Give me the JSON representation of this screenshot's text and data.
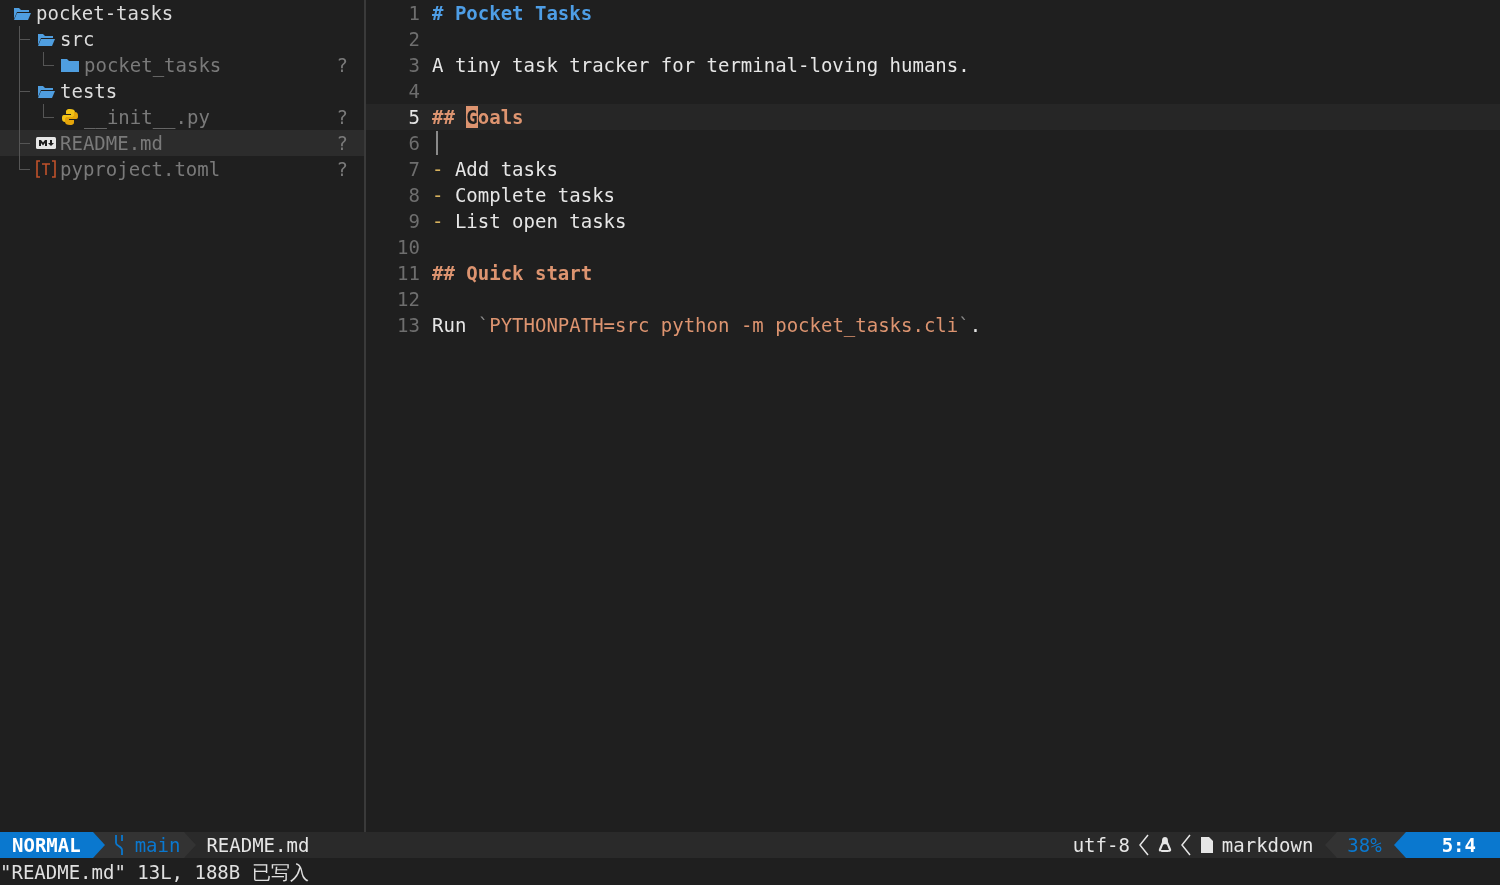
{
  "tree": {
    "root": {
      "name": "pocket-tasks",
      "kind": "open_folder",
      "selected": false,
      "children": [
        {
          "name": "src",
          "kind": "open_folder",
          "selected": false,
          "children": [
            {
              "name": "pocket_tasks",
              "kind": "folder",
              "status": "?",
              "selected": false
            }
          ]
        },
        {
          "name": "tests",
          "kind": "open_folder",
          "selected": false,
          "children": [
            {
              "name": "__init__.py",
              "kind": "python",
              "status": "?",
              "selected": false
            }
          ]
        },
        {
          "name": "README.md",
          "kind": "markdown",
          "status": "?",
          "selected": true
        },
        {
          "name": "pyproject.toml",
          "kind": "toml",
          "status": "?",
          "selected": false
        }
      ]
    }
  },
  "editor": {
    "lines": [
      {
        "number": "1",
        "current": false,
        "segments": [
          {
            "kind": "heading1",
            "text": "# Pocket Tasks"
          }
        ]
      },
      {
        "number": "2",
        "current": false
      },
      {
        "number": "3",
        "current": false,
        "segments": [
          {
            "kind": "text",
            "text": "A tiny task tracker for terminal-loving humans."
          }
        ]
      },
      {
        "number": "4",
        "current": false
      },
      {
        "number": "5",
        "current": true,
        "segments": [
          {
            "kind": "heading2",
            "text": "## "
          },
          {
            "kind": "cursor",
            "text": "G"
          },
          {
            "kind": "heading2",
            "text": "oals"
          }
        ]
      },
      {
        "number": "6",
        "current": false,
        "guide": true
      },
      {
        "number": "7",
        "current": false,
        "segments": [
          {
            "kind": "bullet",
            "text": "-"
          },
          {
            "kind": "text",
            "text": " Add tasks"
          }
        ]
      },
      {
        "number": "8",
        "current": false,
        "segments": [
          {
            "kind": "bullet",
            "text": "-"
          },
          {
            "kind": "text",
            "text": " Complete tasks"
          }
        ]
      },
      {
        "number": "9",
        "current": false,
        "segments": [
          {
            "kind": "bullet",
            "text": "-"
          },
          {
            "kind": "text",
            "text": " List open tasks"
          }
        ]
      },
      {
        "number": "10",
        "current": false
      },
      {
        "number": "11",
        "current": false,
        "segments": [
          {
            "kind": "heading2",
            "text": "## Quick start"
          }
        ]
      },
      {
        "number": "12",
        "current": false
      },
      {
        "number": "13",
        "current": false,
        "segments": [
          {
            "kind": "text",
            "text": "Run "
          },
          {
            "kind": "backtick",
            "text": "`"
          },
          {
            "kind": "code",
            "text": "PYTHONPATH=src python -m pocket_tasks.cli"
          },
          {
            "kind": "backtick",
            "text": "`"
          },
          {
            "kind": "text",
            "text": "."
          }
        ]
      }
    ]
  },
  "status_bar": {
    "mode": "NORMAL",
    "branch": "main",
    "file": "README.md",
    "encoding": "utf-8",
    "filetype": "markdown",
    "progress": "38%",
    "position": "5:4"
  },
  "message": "\"README.md\" 13L, 188B 已写入"
}
